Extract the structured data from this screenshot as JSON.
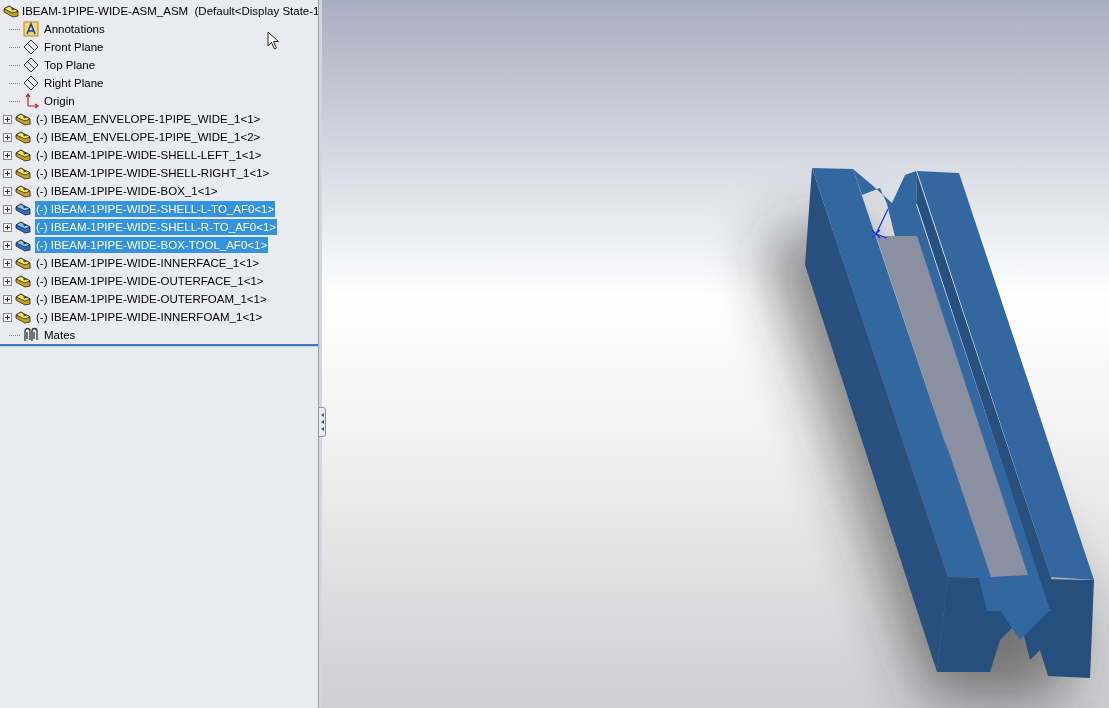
{
  "tree": {
    "root": {
      "label": "IBEAM-1PIPE-WIDE-ASM_ASM  (Default<Display State-1"
    },
    "items": [
      {
        "kind": "annotations",
        "label": "Annotations"
      },
      {
        "kind": "plane",
        "label": "Front Plane"
      },
      {
        "kind": "plane",
        "label": "Top Plane"
      },
      {
        "kind": "plane",
        "label": "Right Plane"
      },
      {
        "kind": "origin",
        "label": "Origin"
      },
      {
        "kind": "part",
        "label": "(-) IBEAM_ENVELOPE-1PIPE_WIDE_1<1>",
        "selected": false,
        "expanded": false
      },
      {
        "kind": "part",
        "label": "(-) IBEAM_ENVELOPE-1PIPE_WIDE_1<2>",
        "selected": false,
        "expanded": false
      },
      {
        "kind": "part",
        "label": "(-) IBEAM-1PIPE-WIDE-SHELL-LEFT_1<1>",
        "selected": false,
        "expanded": false
      },
      {
        "kind": "part",
        "label": "(-) IBEAM-1PIPE-WIDE-SHELL-RIGHT_1<1>",
        "selected": false,
        "expanded": false
      },
      {
        "kind": "part",
        "label": "(-) IBEAM-1PIPE-WIDE-BOX_1<1>",
        "selected": false,
        "expanded": false
      },
      {
        "kind": "part",
        "label": "(-) IBEAM-1PIPE-WIDE-SHELL-L-TO_AF0<1>",
        "selected": true,
        "expanded": false
      },
      {
        "kind": "part",
        "label": "(-) IBEAM-1PIPE-WIDE-SHELL-R-TO_AF0<1>",
        "selected": true,
        "expanded": false
      },
      {
        "kind": "part",
        "label": "(-) IBEAM-1PIPE-WIDE-BOX-TOOL_AF0<1>",
        "selected": true,
        "expanded": false
      },
      {
        "kind": "part",
        "label": "(-) IBEAM-1PIPE-WIDE-INNERFACE_1<1>",
        "selected": false,
        "expanded": false
      },
      {
        "kind": "part",
        "label": "(-) IBEAM-1PIPE-WIDE-OUTERFACE_1<1>",
        "selected": false,
        "expanded": false
      },
      {
        "kind": "part",
        "label": "(-) IBEAM-1PIPE-WIDE-OUTERFOAM_1<1>",
        "selected": false,
        "expanded": false
      },
      {
        "kind": "part",
        "label": "(-) IBEAM-1PIPE-WIDE-INNERFOAM_1<1>",
        "selected": false,
        "expanded": false
      },
      {
        "kind": "mates",
        "label": "Mates"
      }
    ]
  }
}
